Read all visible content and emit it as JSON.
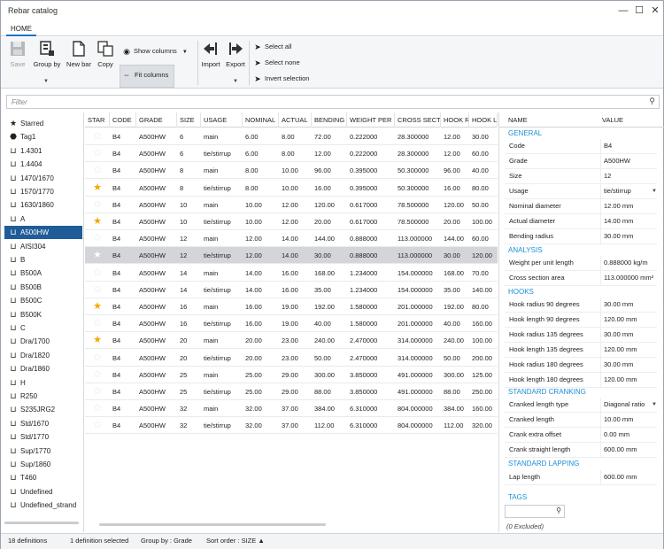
{
  "window": {
    "title": "Rebar catalog",
    "minimize": "—",
    "maximize": "☐",
    "close": "✕"
  },
  "ribbon": {
    "tab": "HOME",
    "save": "Save",
    "group_by": "Group by",
    "new_bar": "New bar",
    "copy": "Copy",
    "show_columns": "Show columns",
    "fit_columns": "Fit columns",
    "import": "Import",
    "export": "Export",
    "select_all": "Select all",
    "select_none": "Select none",
    "invert_selection": "Invert selection"
  },
  "filter": {
    "placeholder": "Filter"
  },
  "tree": [
    {
      "label": "Starred",
      "icon": "star"
    },
    {
      "label": "Tag1",
      "icon": "tag"
    },
    {
      "label": "1.4301",
      "icon": "bar"
    },
    {
      "label": "1.4404",
      "icon": "bar"
    },
    {
      "label": "1470/1670",
      "icon": "bar"
    },
    {
      "label": "1570/1770",
      "icon": "bar"
    },
    {
      "label": "1630/1860",
      "icon": "bar"
    },
    {
      "label": "A",
      "icon": "bar"
    },
    {
      "label": "A500HW",
      "icon": "bar",
      "selected": true
    },
    {
      "label": "AISI304",
      "icon": "bar"
    },
    {
      "label": "B",
      "icon": "bar"
    },
    {
      "label": "B500A",
      "icon": "bar"
    },
    {
      "label": "B500B",
      "icon": "bar"
    },
    {
      "label": "B500C",
      "icon": "bar"
    },
    {
      "label": "B500K",
      "icon": "bar"
    },
    {
      "label": "C",
      "icon": "bar"
    },
    {
      "label": "Dra/1700",
      "icon": "bar"
    },
    {
      "label": "Dra/1820",
      "icon": "bar"
    },
    {
      "label": "Dra/1860",
      "icon": "bar"
    },
    {
      "label": "H",
      "icon": "bar"
    },
    {
      "label": "R250",
      "icon": "bar"
    },
    {
      "label": "S235JRG2",
      "icon": "bar"
    },
    {
      "label": "Std/1670",
      "icon": "bar"
    },
    {
      "label": "Std/1770",
      "icon": "bar"
    },
    {
      "label": "Sup/1770",
      "icon": "bar"
    },
    {
      "label": "Sup/1860",
      "icon": "bar"
    },
    {
      "label": "T460",
      "icon": "bar"
    },
    {
      "label": "Undefined",
      "icon": "bar"
    },
    {
      "label": "Undefined_strand",
      "icon": "bar"
    }
  ],
  "grid": {
    "columns": [
      "STAR",
      "CODE",
      "GRADE",
      "SIZE",
      "USAGE",
      "NOMINAL",
      "ACTUAL",
      "BENDING",
      "WEIGHT PER",
      "CROSS SECT",
      "HOOK R",
      "HOOK L"
    ],
    "rows": [
      {
        "star": false,
        "code": "B4",
        "grade": "A500HW",
        "size": "6",
        "usage": "main",
        "nominal": "6.00",
        "actual": "8.00",
        "bending": "72.00",
        "weight": "0.222000",
        "cross": "28.300000",
        "hook_r": "12.00",
        "hook_l": "30.00"
      },
      {
        "star": false,
        "code": "B4",
        "grade": "A500HW",
        "size": "6",
        "usage": "tie/stirrup",
        "nominal": "6.00",
        "actual": "8.00",
        "bending": "12.00",
        "weight": "0.222000",
        "cross": "28.300000",
        "hook_r": "12.00",
        "hook_l": "60.00"
      },
      {
        "star": false,
        "code": "B4",
        "grade": "A500HW",
        "size": "8",
        "usage": "main",
        "nominal": "8.00",
        "actual": "10.00",
        "bending": "96.00",
        "weight": "0.395000",
        "cross": "50.300000",
        "hook_r": "96.00",
        "hook_l": "40.00"
      },
      {
        "star": true,
        "code": "B4",
        "grade": "A500HW",
        "size": "8",
        "usage": "tie/stirrup",
        "nominal": "8.00",
        "actual": "10.00",
        "bending": "16.00",
        "weight": "0.395000",
        "cross": "50.300000",
        "hook_r": "16.00",
        "hook_l": "80.00"
      },
      {
        "star": false,
        "code": "B4",
        "grade": "A500HW",
        "size": "10",
        "usage": "main",
        "nominal": "10.00",
        "actual": "12.00",
        "bending": "120.00",
        "weight": "0.617000",
        "cross": "78.500000",
        "hook_r": "120.00",
        "hook_l": "50.00"
      },
      {
        "star": true,
        "code": "B4",
        "grade": "A500HW",
        "size": "10",
        "usage": "tie/stirrup",
        "nominal": "10.00",
        "actual": "12.00",
        "bending": "20.00",
        "weight": "0.617000",
        "cross": "78.500000",
        "hook_r": "20.00",
        "hook_l": "100.00"
      },
      {
        "star": false,
        "code": "B4",
        "grade": "A500HW",
        "size": "12",
        "usage": "main",
        "nominal": "12.00",
        "actual": "14.00",
        "bending": "144.00",
        "weight": "0.888000",
        "cross": "113.000000",
        "hook_r": "144.00",
        "hook_l": "60.00"
      },
      {
        "star": false,
        "code": "B4",
        "grade": "A500HW",
        "size": "12",
        "usage": "tie/stirrup",
        "nominal": "12.00",
        "actual": "14.00",
        "bending": "30.00",
        "weight": "0.888000",
        "cross": "113.000000",
        "hook_r": "30.00",
        "hook_l": "120.00",
        "selected": true
      },
      {
        "star": false,
        "code": "B4",
        "grade": "A500HW",
        "size": "14",
        "usage": "main",
        "nominal": "14.00",
        "actual": "16.00",
        "bending": "168.00",
        "weight": "1.234000",
        "cross": "154.000000",
        "hook_r": "168.00",
        "hook_l": "70.00"
      },
      {
        "star": false,
        "code": "B4",
        "grade": "A500HW",
        "size": "14",
        "usage": "tie/stirrup",
        "nominal": "14.00",
        "actual": "16.00",
        "bending": "35.00",
        "weight": "1.234000",
        "cross": "154.000000",
        "hook_r": "35.00",
        "hook_l": "140.00"
      },
      {
        "star": true,
        "code": "B4",
        "grade": "A500HW",
        "size": "16",
        "usage": "main",
        "nominal": "16.00",
        "actual": "19.00",
        "bending": "192.00",
        "weight": "1.580000",
        "cross": "201.000000",
        "hook_r": "192.00",
        "hook_l": "80.00"
      },
      {
        "star": false,
        "code": "B4",
        "grade": "A500HW",
        "size": "16",
        "usage": "tie/stirrup",
        "nominal": "16.00",
        "actual": "19.00",
        "bending": "40.00",
        "weight": "1.580000",
        "cross": "201.000000",
        "hook_r": "40.00",
        "hook_l": "160.00"
      },
      {
        "star": true,
        "code": "B4",
        "grade": "A500HW",
        "size": "20",
        "usage": "main",
        "nominal": "20.00",
        "actual": "23.00",
        "bending": "240.00",
        "weight": "2.470000",
        "cross": "314.000000",
        "hook_r": "240.00",
        "hook_l": "100.00"
      },
      {
        "star": false,
        "code": "B4",
        "grade": "A500HW",
        "size": "20",
        "usage": "tie/stirrup",
        "nominal": "20.00",
        "actual": "23.00",
        "bending": "50.00",
        "weight": "2.470000",
        "cross": "314.000000",
        "hook_r": "50.00",
        "hook_l": "200.00"
      },
      {
        "star": false,
        "code": "B4",
        "grade": "A500HW",
        "size": "25",
        "usage": "main",
        "nominal": "25.00",
        "actual": "29.00",
        "bending": "300.00",
        "weight": "3.850000",
        "cross": "491.000000",
        "hook_r": "300.00",
        "hook_l": "125.00"
      },
      {
        "star": false,
        "code": "B4",
        "grade": "A500HW",
        "size": "25",
        "usage": "tie/stirrup",
        "nominal": "25.00",
        "actual": "29.00",
        "bending": "88.00",
        "weight": "3.850000",
        "cross": "491.000000",
        "hook_r": "88.00",
        "hook_l": "250.00"
      },
      {
        "star": false,
        "code": "B4",
        "grade": "A500HW",
        "size": "32",
        "usage": "main",
        "nominal": "32.00",
        "actual": "37.00",
        "bending": "384.00",
        "weight": "6.310000",
        "cross": "804.000000",
        "hook_r": "384.00",
        "hook_l": "160.00"
      },
      {
        "star": false,
        "code": "B4",
        "grade": "A500HW",
        "size": "32",
        "usage": "tie/stirrup",
        "nominal": "32.00",
        "actual": "37.00",
        "bending": "112.00",
        "weight": "6.310000",
        "cross": "804.000000",
        "hook_r": "112.00",
        "hook_l": "320.00"
      }
    ]
  },
  "properties": {
    "header_name": "NAME",
    "header_value": "VALUE",
    "general": "GENERAL",
    "code_name": "Code",
    "code_value": "B4",
    "grade_name": "Grade",
    "grade_value": "A500HW",
    "size_name": "Size",
    "size_value": "12",
    "usage_name": "Usage",
    "usage_value": "tie/stirrup",
    "nominal_name": "Nominal diameter",
    "nominal_value": "12.00 mm",
    "actual_name": "Actual diameter",
    "actual_value": "14.00 mm",
    "bending_name": "Bending radius",
    "bending_value": "30.00 mm",
    "analysis": "ANALYSIS",
    "weight_name": "Weight per unit length",
    "weight_value": "0.888000 kg/m",
    "cross_name": "Cross section area",
    "cross_value": "113.000000 mm²",
    "hooks": "HOOKS",
    "hr90_name": "Hook radius 90 degrees",
    "hr90_value": "30.00 mm",
    "hl90_name": "Hook length 90 degrees",
    "hl90_value": "120.00 mm",
    "hr135_name": "Hook radius 135 degrees",
    "hr135_value": "30.00 mm",
    "hl135_name": "Hook length 135 degrees",
    "hl135_value": "120.00 mm",
    "hr180_name": "Hook radius 180 degrees",
    "hr180_value": "30.00 mm",
    "hl180_name": "Hook length 180 degrees",
    "hl180_value": "120.00 mm",
    "cranking": "STANDARD CRANKING",
    "clt_name": "Cranked length type",
    "clt_value": "Diagonal ratio",
    "cl_name": "Cranked length",
    "cl_value": "10.00 mm",
    "ceo_name": "Crank extra offset",
    "ceo_value": "0.00 mm",
    "csl_name": "Crank straight length",
    "csl_value": "600.00 mm",
    "lapping": "STANDARD LAPPING",
    "lap_name": "Lap length",
    "lap_value": "600.00 mm",
    "tags": "TAGS",
    "excluded": "(0 Excluded)"
  },
  "status": {
    "definitions": "18 definitions",
    "selected": "1 definition selected",
    "group_by": "Group by : Grade",
    "sort_order": "Sort order : SIZE ▲"
  },
  "colors": {
    "accent": "#1b8fd6",
    "selection": "#1f5c98",
    "star": "#f2a900"
  }
}
